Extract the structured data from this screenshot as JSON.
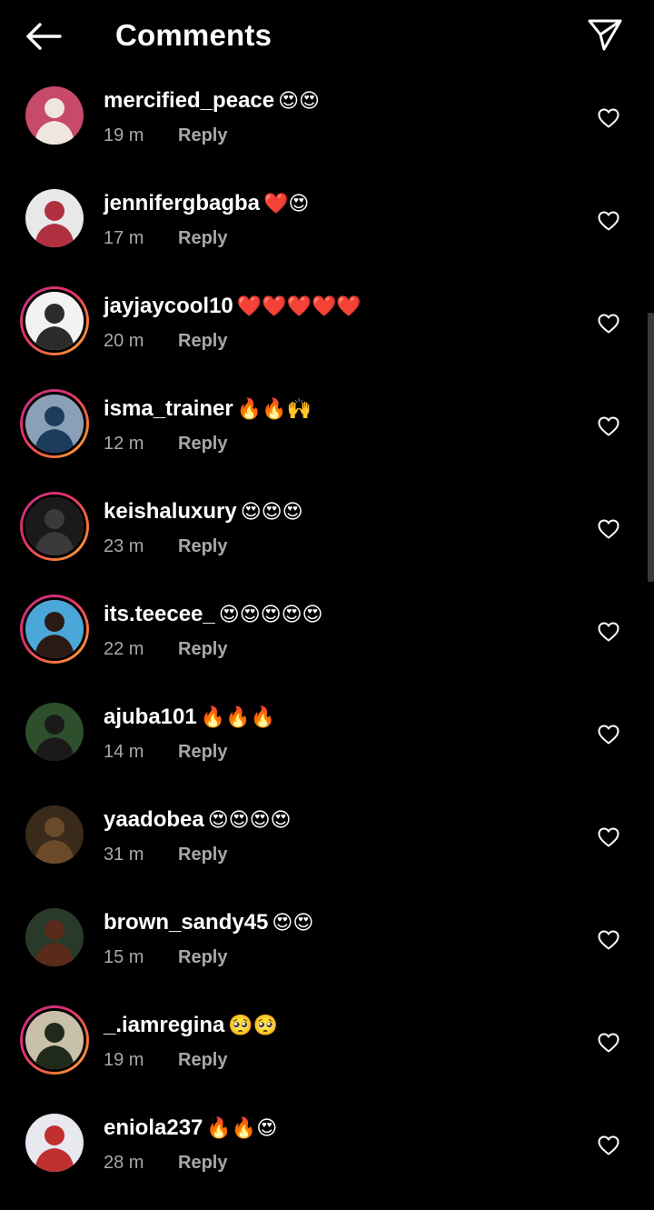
{
  "header": {
    "title": "Comments",
    "back_icon": "arrow-left-icon",
    "send_icon": "paper-plane-icon"
  },
  "reply_label": "Reply",
  "colors": {
    "background": "#000000",
    "text": "#ffffff",
    "meta_text": "#a8a8a8",
    "story_ring_start": "#c13584",
    "story_ring_end": "#fcaf45"
  },
  "comments": [
    {
      "username": "mercified_peace",
      "text": "😍😍",
      "time": "19 m",
      "story_ring": false,
      "avatar_colors": [
        "#c84a6a",
        "#f0e6e0"
      ]
    },
    {
      "username": "jennifergbagba",
      "text": "❤️😍",
      "time": "17 m",
      "story_ring": false,
      "avatar_colors": [
        "#e8e8e8",
        "#b03040"
      ]
    },
    {
      "username": "jayjaycool10",
      "text": "❤️❤️❤️❤️❤️",
      "time": "20 m",
      "story_ring": true,
      "avatar_colors": [
        "#f2f2f2",
        "#2b2b2b"
      ]
    },
    {
      "username": "isma_trainer",
      "text": "🔥🔥🙌",
      "time": "12 m",
      "story_ring": true,
      "avatar_colors": [
        "#8aa0b8",
        "#1d3b5c"
      ]
    },
    {
      "username": "keishaluxury",
      "text": "😍😍😍",
      "time": "23 m",
      "story_ring": true,
      "avatar_colors": [
        "#1a1a1a",
        "#3a3a3a"
      ]
    },
    {
      "username": "its.teecee_",
      "text": "😍😍😍😍😍",
      "time": "22 m",
      "story_ring": true,
      "avatar_colors": [
        "#4aa7d8",
        "#2b1a14"
      ]
    },
    {
      "username": "ajuba101",
      "text": "🔥🔥🔥",
      "time": "14 m",
      "story_ring": false,
      "avatar_colors": [
        "#2e4f2c",
        "#1a1a1a"
      ]
    },
    {
      "username": "yaadobea",
      "text": "😍😍😍😍",
      "time": "31 m",
      "story_ring": false,
      "avatar_colors": [
        "#3a2a1a",
        "#6b4a2a"
      ]
    },
    {
      "username": "brown_sandy45",
      "text": "😍😍",
      "time": "15 m",
      "story_ring": false,
      "avatar_colors": [
        "#2a3a2a",
        "#5a2a1a"
      ]
    },
    {
      "username": "_.iamregina",
      "text": "🥺🥺",
      "time": "19 m",
      "story_ring": true,
      "avatar_colors": [
        "#c8c0a8",
        "#1f2a1a"
      ]
    },
    {
      "username": "eniola237",
      "text": "🔥🔥😍",
      "time": "28 m",
      "story_ring": false,
      "avatar_colors": [
        "#e8e8f0",
        "#c03030"
      ]
    }
  ]
}
